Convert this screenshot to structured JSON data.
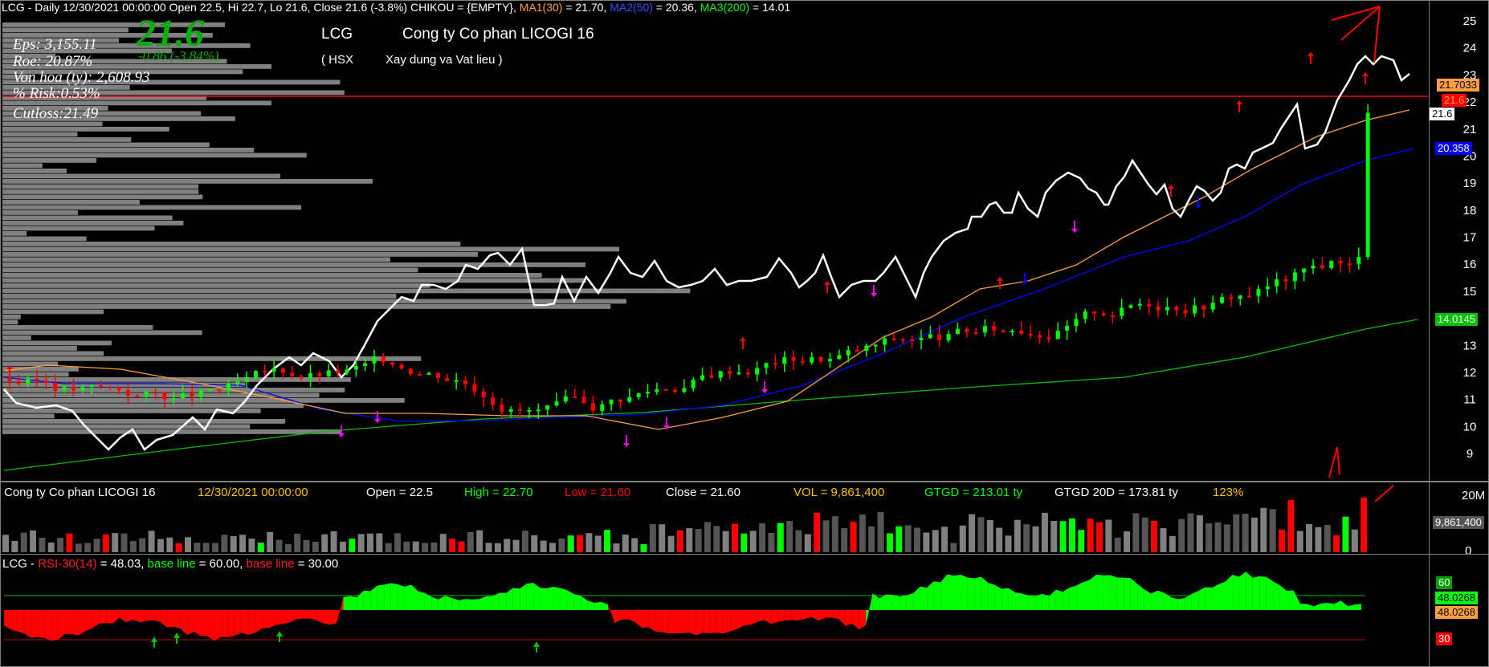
{
  "header": {
    "prefix": "LCG - Daily 12/30/2021 00:00:00 Open 22.5, Hi 22.7, Lo 21.6, Close 21.6 (-3.8%) CHIKOU = {EMPTY},",
    "ma1_label": "MA1(30)",
    "ma1_value": " = 21.70,",
    "ma2_label": "MA2(50)",
    "ma2_value": " = 20.36,",
    "ma3_label": "MA3(200)",
    "ma3_value": " = 14.01"
  },
  "price_big": "21.6",
  "price_change": "-0.86 (-3.84%)",
  "info": {
    "eps": "Eps: 3,155.11",
    "roe": "Roe: 20.87%",
    "von_hoa": "Von hoa (ty): 2,608.93",
    "risk": "% Risk:0.53%",
    "cutloss": "Cutloss:21.49"
  },
  "company": {
    "ticker": "LCG",
    "name": "Cong ty Co phan LICOGI 16",
    "exchange": "( HSX",
    "sector": "Xay dung va Vat lieu )"
  },
  "volume_header": {
    "company": "Cong ty Co phan LICOGI 16",
    "date": "12/30/2021 00:00:00",
    "open": "Open = 22.5",
    "high": "High = 22.70",
    "low": "Low = 21.60",
    "close": "Close = 21.60",
    "vol": "VOL = 9,861,400",
    "gtgd": "GTGD = 213.01  ty",
    "gtgd20": "GTGD 20D = 173.81  ty",
    "pct": "123%"
  },
  "rsi_header": {
    "prefix": "LCG - ",
    "rsi_label": "RSI-30(14)",
    "rsi_value": " = 48.03, ",
    "base1_label": "base line",
    "base1_value": " = 60.00, ",
    "base2_label": "base line",
    "base2_value": " = 30.00"
  },
  "price_axis": [
    "25",
    "24",
    "23",
    "22",
    "21",
    "20",
    "19",
    "18",
    "17",
    "16",
    "15",
    "14",
    "13",
    "12",
    "11",
    "10",
    "9"
  ],
  "price_tags": {
    "ma1": "21.7033",
    "ma1_color": "#ffa040",
    "close_red": "21.6",
    "close_white": "21.6",
    "ma2": "20.358",
    "ma3": "14.0145"
  },
  "volume_axis": [
    "20M",
    "0"
  ],
  "volume_tag": "9,861,400",
  "rsi_axis": {
    "top_tag": "60",
    "rsi_tag_green": "48.0268",
    "rsi_tag_orange": "48.0268",
    "bottom_tag": "30"
  },
  "colors": {
    "up": "#00ff00",
    "down": "#ff0000",
    "ma1": "#ffa040",
    "ma2": "#0000ff",
    "ma3": "#00c000",
    "chikou": "#ffffff",
    "profile": "#808080"
  },
  "chart_data": {
    "type": "line",
    "series": [
      {
        "name": "MA1(30)",
        "last": 21.7
      },
      {
        "name": "MA2(50)",
        "last": 20.36
      },
      {
        "name": "MA3(200)",
        "last": 14.01
      },
      {
        "name": "RSI-30(14)",
        "last": 48.03
      }
    ],
    "price_ylim": [
      8.5,
      25.5
    ],
    "rsi_base_lines": [
      60,
      30
    ],
    "last_close": 21.6,
    "last_volume": 9861400
  }
}
